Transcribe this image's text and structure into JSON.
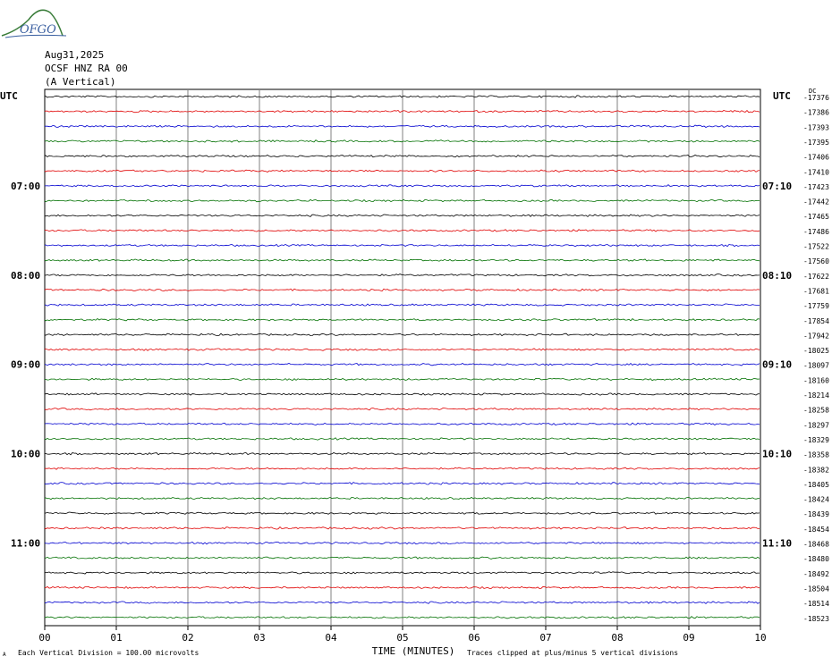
{
  "logo": {
    "text": "OFGO",
    "color": "#3a7d3a"
  },
  "header": {
    "date": "Aug31,2025",
    "station": "OCSF HNZ RA 00",
    "component": "(A Vertical)"
  },
  "chart_data": {
    "type": "line",
    "left_axis_label": "UTC",
    "right_axis_label": "UTC",
    "right_header_label": "DC",
    "xlabel": "TIME (MINUTES)",
    "x_ticks": [
      "00",
      "01",
      "02",
      "03",
      "04",
      "05",
      "06",
      "07",
      "08",
      "09",
      "10"
    ],
    "xlim": [
      0,
      10
    ],
    "grid": true,
    "trace_colors": [
      "#000000",
      "#e00000",
      "#0000d0",
      "#007000"
    ],
    "left_time_labels": [
      {
        "row": 6,
        "label": "07:00"
      },
      {
        "row": 12,
        "label": "08:00"
      },
      {
        "row": 18,
        "label": "09:00"
      },
      {
        "row": 24,
        "label": "10:00"
      },
      {
        "row": 30,
        "label": "11:00"
      }
    ],
    "right_time_labels": [
      {
        "row": 6,
        "label": "07:10"
      },
      {
        "row": 12,
        "label": "08:10"
      },
      {
        "row": 18,
        "label": "09:10"
      },
      {
        "row": 24,
        "label": "10:10"
      },
      {
        "row": 30,
        "label": "11:10"
      }
    ],
    "dc_offsets": [
      -17376,
      -17386,
      -17393,
      -17395,
      -17406,
      -17410,
      -17423,
      -17442,
      -17465,
      -17486,
      -17522,
      -17560,
      -17622,
      -17681,
      -17759,
      -17854,
      -17942,
      -18025,
      -18097,
      -18160,
      -18214,
      -18258,
      -18297,
      -18329,
      -18358,
      -18382,
      -18405,
      -18424,
      -18439,
      -18454,
      -18468,
      -18480,
      -18492,
      -18504,
      -18514,
      -18523
    ]
  },
  "footer": {
    "scale_note": "Each Vertical Division =  100.00 microvolts",
    "clip_note": "Traces clipped at plus/minus 5 vertical divisions",
    "corner_mark": "A"
  }
}
